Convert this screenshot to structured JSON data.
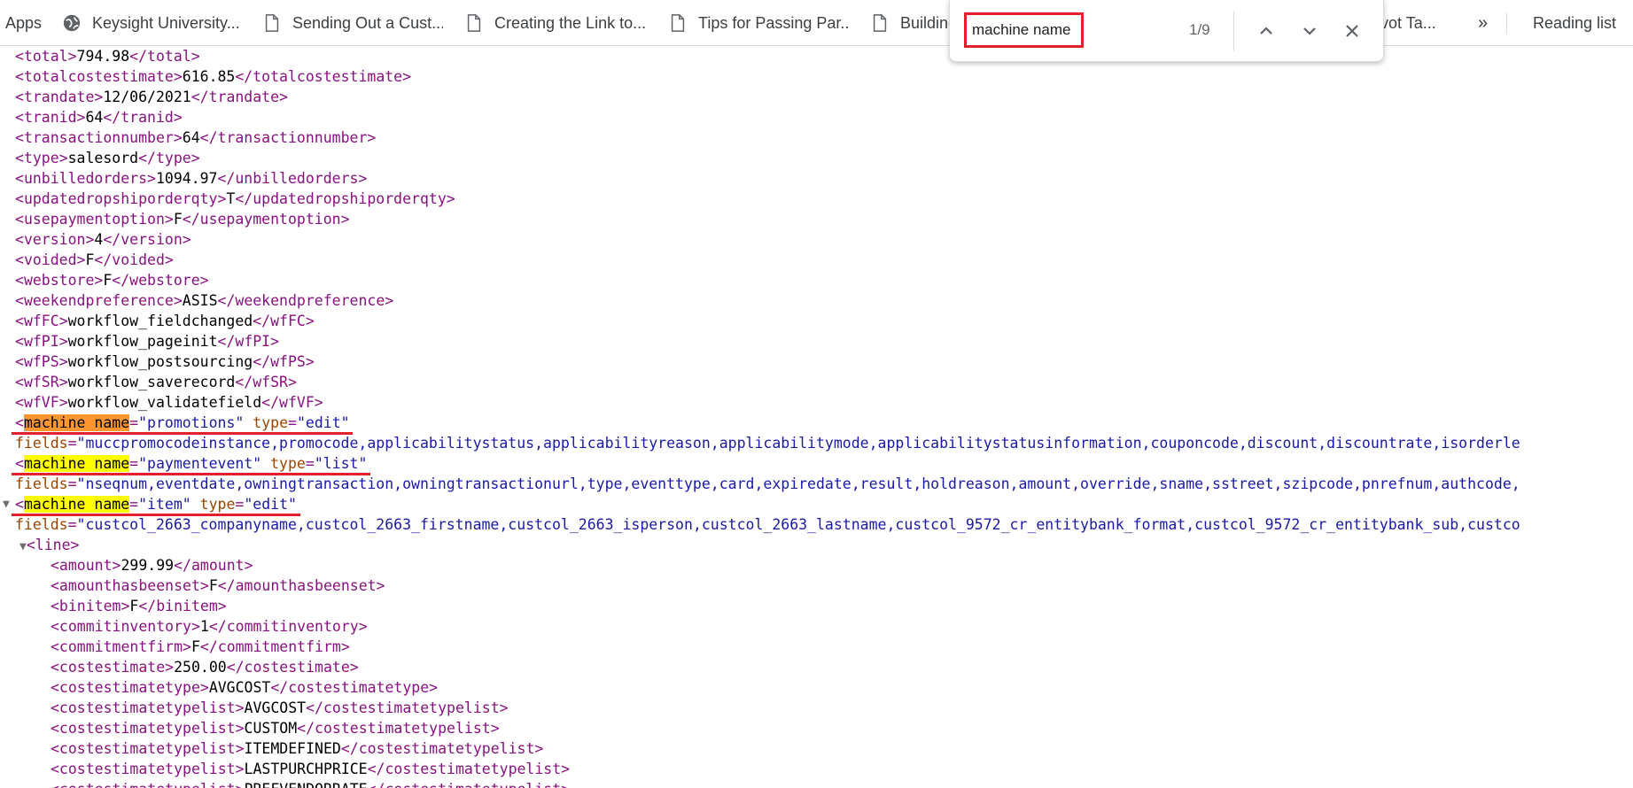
{
  "bookmarks": {
    "apps_label": "Apps",
    "items": [
      {
        "label": "Keysight University...",
        "icon": "globe-icon"
      },
      {
        "label": "Sending Out a Cust...",
        "icon": "page-icon"
      },
      {
        "label": "Creating the Link to...",
        "icon": "page-icon"
      },
      {
        "label": "Tips for Passing Par...",
        "icon": "page-icon"
      },
      {
        "label": "Building",
        "icon": "page-icon"
      },
      {
        "label": "vot Ta...",
        "icon": "page-icon"
      }
    ],
    "overflow_label": "»",
    "reading_list_label": "Reading list"
  },
  "findbar": {
    "query": "machine name",
    "count": "1/9"
  },
  "xml": {
    "lines": [
      {
        "indent": "  ",
        "tag": "total",
        "value": "794.98"
      },
      {
        "indent": "  ",
        "tag": "totalcostestimate",
        "value": "616.85"
      },
      {
        "indent": "  ",
        "tag": "trandate",
        "value": "12/06/2021"
      },
      {
        "indent": "  ",
        "tag": "tranid",
        "value": "64"
      },
      {
        "indent": "  ",
        "tag": "transactionnumber",
        "value": "64"
      },
      {
        "indent": "  ",
        "tag": "type",
        "value": "salesord"
      },
      {
        "indent": "  ",
        "tag": "unbilledorders",
        "value": "1094.97"
      },
      {
        "indent": "  ",
        "tag": "updatedropshiporderqty",
        "value": "T"
      },
      {
        "indent": "  ",
        "tag": "usepaymentoption",
        "value": "F"
      },
      {
        "indent": "  ",
        "tag": "version",
        "value": "4"
      },
      {
        "indent": "  ",
        "tag": "voided",
        "value": "F"
      },
      {
        "indent": "  ",
        "tag": "webstore",
        "value": "F"
      },
      {
        "indent": "  ",
        "tag": "weekendpreference",
        "value": "ASIS"
      },
      {
        "indent": "  ",
        "tag": "wfFC",
        "value": "workflow_fieldchanged"
      },
      {
        "indent": "  ",
        "tag": "wfPI",
        "value": "workflow_pageinit"
      },
      {
        "indent": "  ",
        "tag": "wfPS",
        "value": "workflow_postsourcing"
      },
      {
        "indent": "  ",
        "tag": "wfSR",
        "value": "workflow_saverecord"
      },
      {
        "indent": "  ",
        "tag": "wfVF",
        "value": "workflow_validatefield"
      }
    ],
    "machines": [
      {
        "name": "promotions",
        "type": "edit",
        "current": true,
        "fields": "muccpromocodeinstance,promocode,applicabilitystatus,applicabilityreason,applicabilitymode,applicabilitystatusinformation,couponcode,discount,discountrate,isorderle"
      },
      {
        "name": "paymentevent",
        "type": "list",
        "current": false,
        "fields": "nseqnum,eventdate,owningtransaction,owningtransactionurl,type,eventtype,card,expiredate,result,holdreason,amount,override,sname,sstreet,szipcode,pnrefnum,authcode,"
      },
      {
        "name": "item",
        "type": "edit",
        "current": false,
        "fields": "custcol_2663_companyname,custcol_2663_firstname,custcol_2663_isperson,custcol_2663_lastname,custcol_9572_cr_entitybank_format,custcol_9572_cr_entitybank_sub,custco"
      }
    ],
    "match_text_1": "machine",
    "match_text_2": "name",
    "attr_type": "type",
    "attr_fields": "fields",
    "line_tag": "line",
    "line_items": [
      {
        "tag": "amount",
        "value": "299.99"
      },
      {
        "tag": "amounthasbeenset",
        "value": "F"
      },
      {
        "tag": "binitem",
        "value": "F"
      },
      {
        "tag": "commitinventory",
        "value": "1"
      },
      {
        "tag": "commitmentfirm",
        "value": "F"
      },
      {
        "tag": "costestimate",
        "value": "250.00"
      },
      {
        "tag": "costestimatetype",
        "value": "AVGCOST"
      },
      {
        "tag": "costestimatetypelist",
        "value": "AVGCOST"
      },
      {
        "tag": "costestimatetypelist",
        "value": "CUSTOM"
      },
      {
        "tag": "costestimatetypelist",
        "value": "ITEMDEFINED"
      },
      {
        "tag": "costestimatetypelist",
        "value": "LASTPURCHPRICE"
      },
      {
        "tag": "costestimatetypelist",
        "value": "PREFVENDORRATE"
      }
    ]
  },
  "colors": {
    "tag": "#881280",
    "attribute": "#994500",
    "attribute_value": "#1a1aa6",
    "current_match": "#ff9632",
    "match": "#ffff00",
    "annotation_red": "#e3202b"
  }
}
